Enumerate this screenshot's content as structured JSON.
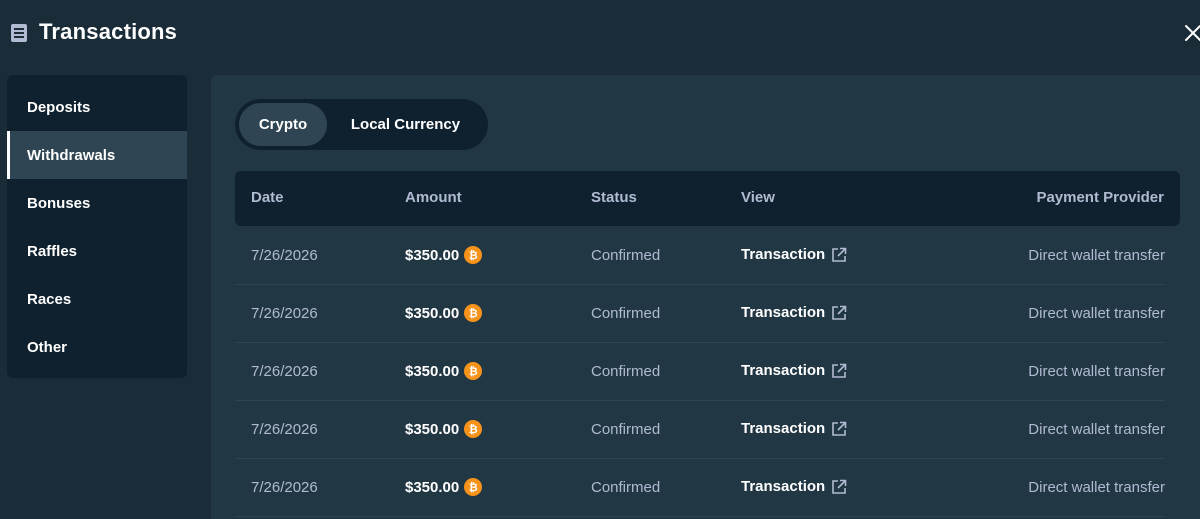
{
  "header": {
    "title": "Transactions",
    "icon": "receipt-icon",
    "close_icon": "close-icon"
  },
  "sidebar": {
    "items": [
      {
        "label": "Deposits",
        "active": false
      },
      {
        "label": "Withdrawals",
        "active": true
      },
      {
        "label": "Bonuses",
        "active": false
      },
      {
        "label": "Raffles",
        "active": false
      },
      {
        "label": "Races",
        "active": false
      },
      {
        "label": "Other",
        "active": false
      }
    ]
  },
  "toggle": {
    "options": [
      "Crypto",
      "Local Currency"
    ],
    "selected": "Crypto"
  },
  "table": {
    "columns": [
      "Date",
      "Amount",
      "Status",
      "View",
      "Payment Provider"
    ],
    "rows": [
      {
        "date": "7/26/2026",
        "amount": "$350.00",
        "currency_icon": "bitcoin-icon",
        "status": "Confirmed",
        "view": "Transaction",
        "provider": "Direct wallet transfer"
      },
      {
        "date": "7/26/2026",
        "amount": "$350.00",
        "currency_icon": "bitcoin-icon",
        "status": "Confirmed",
        "view": "Transaction",
        "provider": "Direct wallet transfer"
      },
      {
        "date": "7/26/2026",
        "amount": "$350.00",
        "currency_icon": "bitcoin-icon",
        "status": "Confirmed",
        "view": "Transaction",
        "provider": "Direct wallet transfer"
      },
      {
        "date": "7/26/2026",
        "amount": "$350.00",
        "currency_icon": "bitcoin-icon",
        "status": "Confirmed",
        "view": "Transaction",
        "provider": "Direct wallet transfer"
      },
      {
        "date": "7/26/2026",
        "amount": "$350.00",
        "currency_icon": "bitcoin-icon",
        "status": "Confirmed",
        "view": "Transaction",
        "provider": "Direct wallet transfer"
      }
    ]
  },
  "colors": {
    "background": "#1a2c38",
    "panel": "#213743",
    "dark": "#0f212e",
    "active": "#2f4553",
    "muted_text": "#b1bad3",
    "bitcoin": "#f7931a"
  }
}
